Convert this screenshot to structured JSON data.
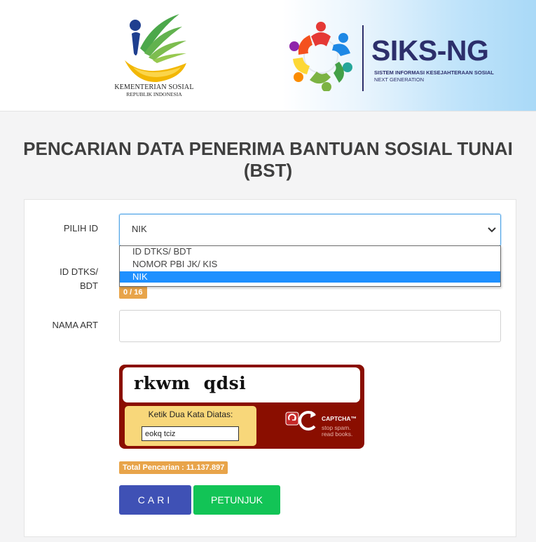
{
  "header": {
    "kemensos": {
      "line1": "KEMENTERIAN SOSIAL",
      "line2": "REPUBLIK INDONESIA"
    },
    "siks": {
      "title": "SIKS-NG",
      "subtitle1": "SISTEM INFORMASI KESEJAHTERAAN SOSIAL",
      "subtitle2": "NEXT GENERATION"
    }
  },
  "page": {
    "title": "PENCARIAN DATA PENERIMA BANTUAN SOSIAL TUNAI (BST)"
  },
  "form": {
    "pilih_id": {
      "label": "PILIH ID",
      "value": "NIK",
      "options": [
        "ID DTKS/ BDT",
        "NOMOR PBI JK/ KIS",
        "NIK"
      ]
    },
    "id_field": {
      "label_line1": "ID DTKS/",
      "label_line2": "BDT",
      "counter": "0 / 16"
    },
    "nama_art": {
      "label": "NAMA ART",
      "value": ""
    },
    "captcha": {
      "challenge": "rkwm qdsi",
      "prompt": "Ketik Dua Kata Diatas:",
      "input_value": "eokq tciz",
      "brand": "CAPTCHA™",
      "tagline1": "stop spam.",
      "tagline2": "read books."
    },
    "total_search": "Total Pencarian : 11.137.897",
    "buttons": {
      "search": "CARI",
      "guide": "PETUNJUK"
    }
  },
  "colors": {
    "primary_button": "#3f51b5",
    "guide_button": "#12c456",
    "badge": "#e8a44a",
    "captcha_bg": "#8a0e00",
    "selected_option": "#1e90ff"
  }
}
